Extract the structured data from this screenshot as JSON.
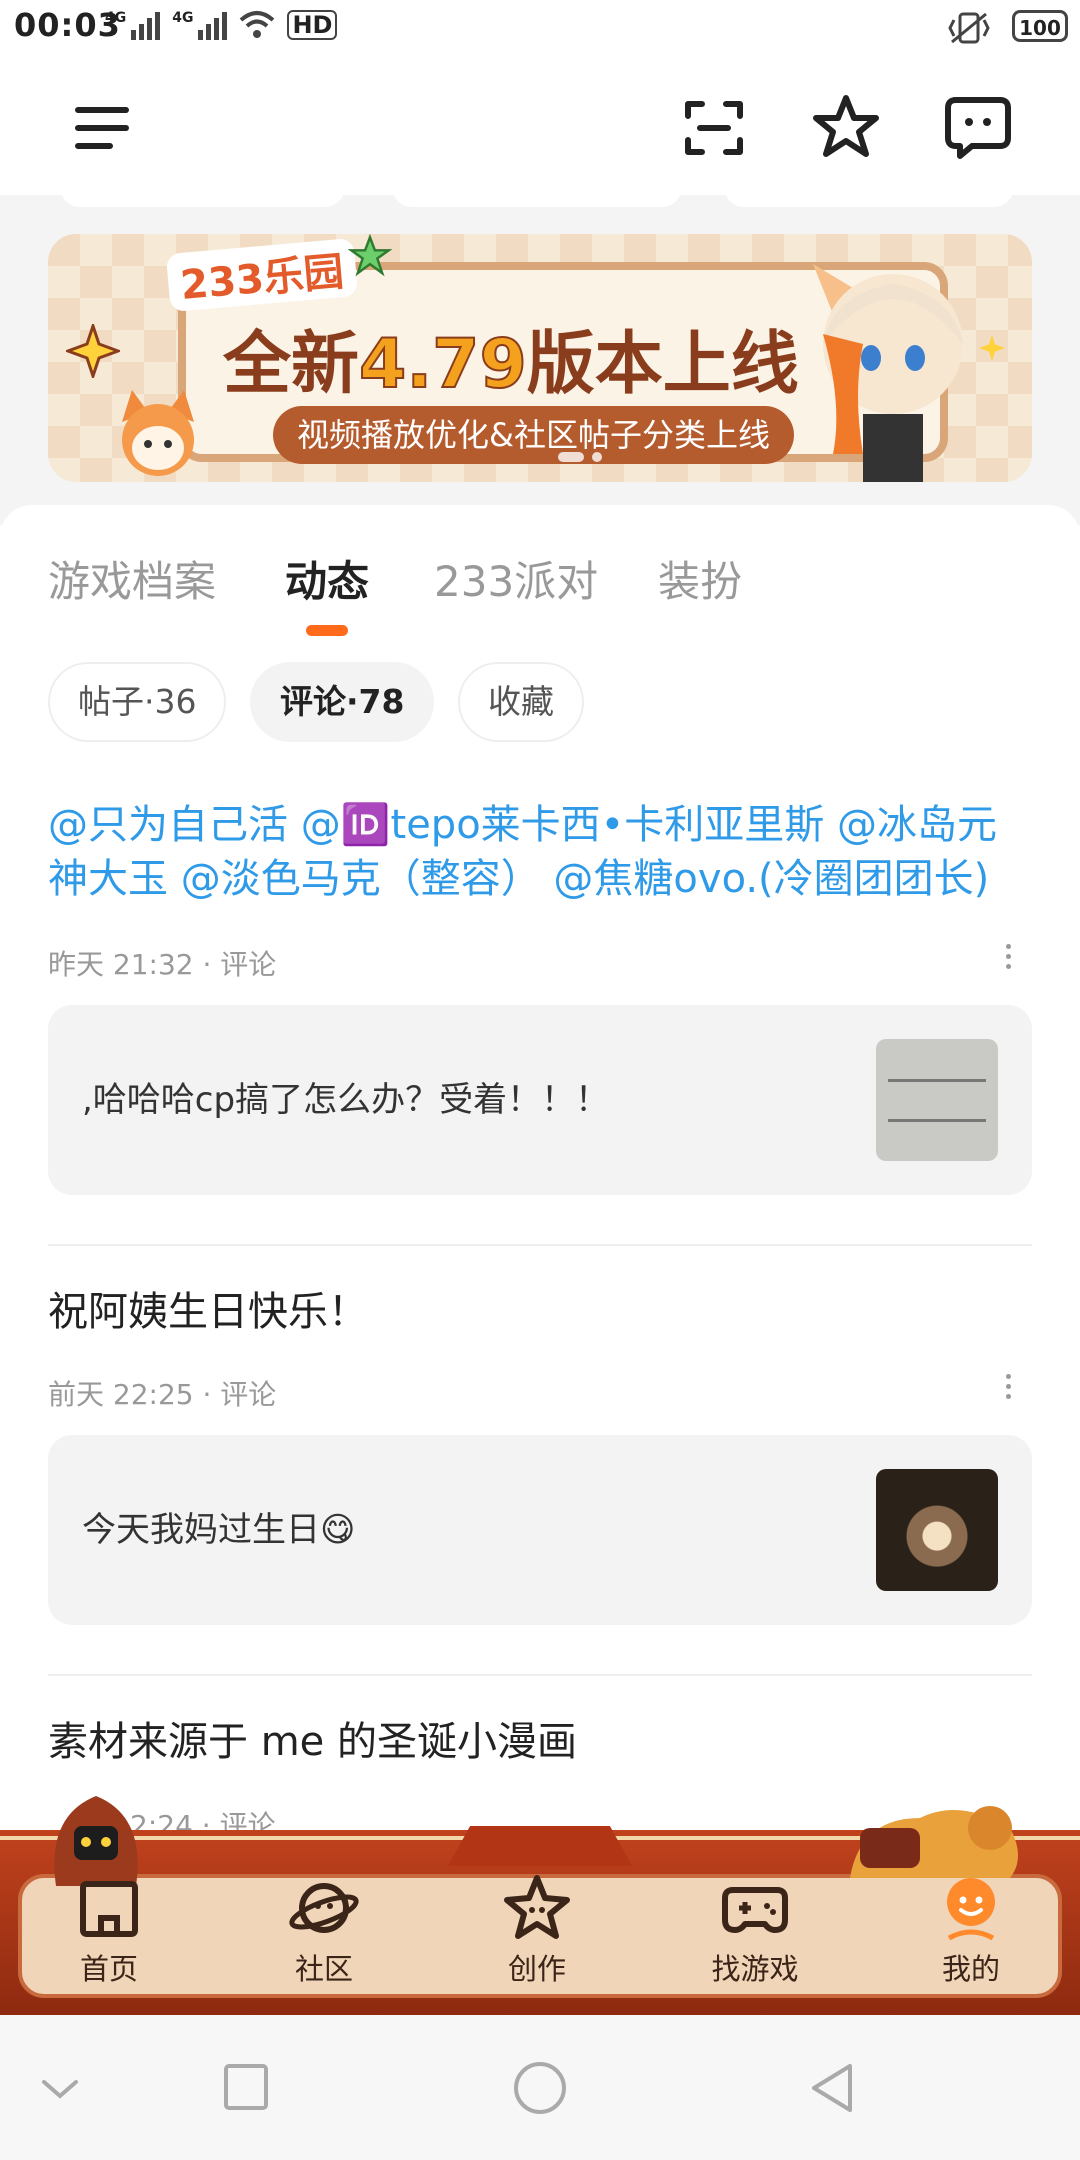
{
  "status_bar": {
    "time": "00:03",
    "net1": "4G",
    "net2": "4G",
    "hd": "HD",
    "battery": "100"
  },
  "toolbar": {
    "icons": [
      "menu-icon",
      "scan-icon",
      "star-icon",
      "message-icon"
    ]
  },
  "banner": {
    "brand": "233乐园",
    "headline_prefix": "全新",
    "version": "4.79",
    "headline_suffix": "版本上线",
    "subtitle": "视频播放优化&社区帖子分类上线"
  },
  "tabs": [
    {
      "label": "游戏档案",
      "active": false
    },
    {
      "label": "动态",
      "active": true
    },
    {
      "label": "233派对",
      "active": false
    },
    {
      "label": "装扮",
      "active": false
    }
  ],
  "chips": [
    {
      "label": "帖子·36",
      "active": false
    },
    {
      "label": "评论·78",
      "active": true
    },
    {
      "label": "收藏",
      "active": false
    }
  ],
  "feed": [
    {
      "title_lines": [
        "@只为自己活 @🆔tepo莱卡西•卡利亚里斯 @冰岛元",
        "神大玉 @淡色马克（整容） @焦糖ovo.(冷圈团团长)"
      ],
      "meta": "昨天 21:32 · 评论",
      "quote": ",哈哈哈cp搞了怎么办？受着！！！"
    },
    {
      "title_lines": [
        "祝阿姨生日快乐！"
      ],
      "meta": "前天 22:25 · 评论",
      "quote": "今天我妈过生日😋"
    },
    {
      "title_lines": [
        "素材来源于 me 的圣诞小漫画"
      ],
      "meta": "2:24 · 评论"
    }
  ],
  "bottom_nav": [
    {
      "label": "首页",
      "icon": "home-icon"
    },
    {
      "label": "社区",
      "icon": "community-planet-icon"
    },
    {
      "label": "创作",
      "icon": "create-star-icon"
    },
    {
      "label": "找游戏",
      "icon": "gamepad-icon"
    },
    {
      "label": "我的",
      "icon": "profile-avatar-icon",
      "active": true
    }
  ],
  "colors": {
    "accent": "#ff6a1b",
    "mention": "#2f9ae8",
    "nav_bar": "#b23616"
  }
}
